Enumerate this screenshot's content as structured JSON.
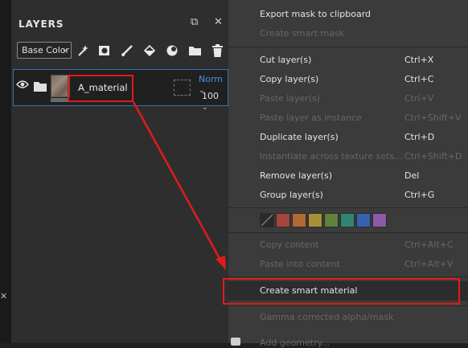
{
  "layers_panel": {
    "title": "LAYERS",
    "pin_icon": "⧉",
    "close_icon": "✕",
    "channel_select": "Base Color",
    "layer": {
      "name": "A_material",
      "blend_mode": "Norm",
      "opacity": "100"
    }
  },
  "context_menu": {
    "items": [
      {
        "label": "Export mask to clipboard",
        "shortcut": "",
        "enabled": true
      },
      {
        "label": "Create smart mask",
        "shortcut": "",
        "enabled": false
      },
      {
        "label": "Cut layer(s)",
        "shortcut": "Ctrl+X",
        "enabled": true
      },
      {
        "label": "Copy layer(s)",
        "shortcut": "Ctrl+C",
        "enabled": true
      },
      {
        "label": "Paste layer(s)",
        "shortcut": "Ctrl+V",
        "enabled": false
      },
      {
        "label": "Paste layer as instance",
        "shortcut": "Ctrl+Shift+V",
        "enabled": false
      },
      {
        "label": "Duplicate layer(s)",
        "shortcut": "Ctrl+D",
        "enabled": true
      },
      {
        "label": "Instantiate across texture sets...",
        "shortcut": "Ctrl+Shift+D",
        "enabled": false
      },
      {
        "label": "Remove layer(s)",
        "shortcut": "Del",
        "enabled": true
      },
      {
        "label": "Group layer(s)",
        "shortcut": "Ctrl+G",
        "enabled": true
      },
      {
        "label": "Copy content",
        "shortcut": "Ctrl+Alt+C",
        "enabled": false
      },
      {
        "label": "Paste into content",
        "shortcut": "Ctrl+Alt+V",
        "enabled": false
      },
      {
        "label": "Create smart material",
        "shortcut": "",
        "enabled": true
      },
      {
        "label": "Gamma corrected alpha/mask",
        "shortcut": "",
        "enabled": false
      },
      {
        "label": "Add geometry...",
        "shortcut": "",
        "enabled": false
      }
    ],
    "color_swatches": [
      "#a6453b",
      "#b26a35",
      "#a8903a",
      "#5f843c",
      "#2f8770",
      "#3562b0",
      "#8c5aa6"
    ]
  },
  "annotation_color": "#e01b1b"
}
